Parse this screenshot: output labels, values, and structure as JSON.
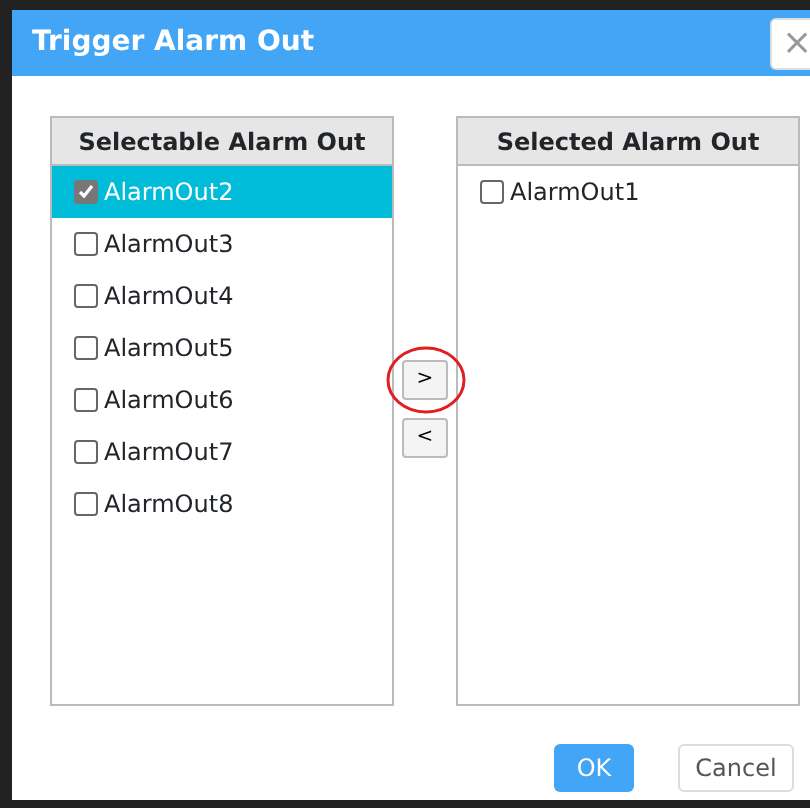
{
  "dialog": {
    "title": "Trigger Alarm Out",
    "close": "×"
  },
  "selectable": {
    "header": "Selectable Alarm Out",
    "items": [
      {
        "label": "AlarmOut2",
        "checked": true,
        "selected": true
      },
      {
        "label": "AlarmOut3",
        "checked": false,
        "selected": false
      },
      {
        "label": "AlarmOut4",
        "checked": false,
        "selected": false
      },
      {
        "label": "AlarmOut5",
        "checked": false,
        "selected": false
      },
      {
        "label": "AlarmOut6",
        "checked": false,
        "selected": false
      },
      {
        "label": "AlarmOut7",
        "checked": false,
        "selected": false
      },
      {
        "label": "AlarmOut8",
        "checked": false,
        "selected": false
      }
    ]
  },
  "move_buttons": [
    {
      "label": ">",
      "highlighted": true
    },
    {
      "label": "<",
      "highlighted": false
    }
  ],
  "selected": {
    "header": "Selected Alarm Out",
    "items": [
      {
        "label": "AlarmOut1",
        "checked": false,
        "selected": false
      }
    ]
  },
  "buttons": [
    {
      "label": "OK",
      "kind": "primary"
    },
    {
      "label": "Cancel",
      "kind": "secondary"
    }
  ]
}
